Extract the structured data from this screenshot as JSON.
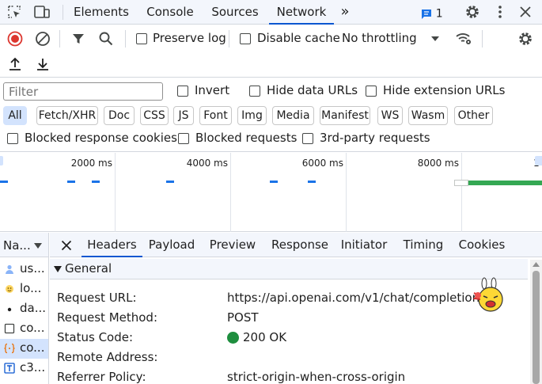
{
  "panel_tabs": [
    {
      "label": "Elements"
    },
    {
      "label": "Console"
    },
    {
      "label": "Sources"
    },
    {
      "label": "Network"
    }
  ],
  "more_tabs_icon": "»",
  "issues": {
    "count": "1"
  },
  "toolbar": {
    "preserve_log_label": "Preserve log",
    "disable_cache_label": "Disable cache",
    "throttling_value": "No throttling"
  },
  "filter": {
    "placeholder": "Filter",
    "invert_label": "Invert",
    "hide_data_urls_label": "Hide data URLs",
    "hide_extension_urls_label": "Hide extension URLs",
    "type_chips": [
      "All",
      "Fetch/XHR",
      "Doc",
      "CSS",
      "JS",
      "Font",
      "Img",
      "Media",
      "Manifest",
      "WS",
      "Wasm",
      "Other"
    ],
    "active_chip": "All",
    "blocked_response_cookies_label": "Blocked response cookies",
    "blocked_requests_label": "Blocked requests",
    "third_party_label": "3rd-party requests"
  },
  "overview": {
    "ticks": [
      "2000 ms",
      "4000 ms",
      "6000 ms",
      "8000 ms",
      "1"
    ]
  },
  "requests_column": {
    "header": "Na...",
    "rows": [
      {
        "name": "us...",
        "icon": "user-icon"
      },
      {
        "name": "lo...",
        "icon": "image-icon"
      },
      {
        "name": "da...",
        "icon": "dot-icon"
      },
      {
        "name": "co...",
        "icon": "blank-doc-icon"
      },
      {
        "name": "co...",
        "icon": "xhr-braces-icon",
        "selected": true
      },
      {
        "name": "c3...",
        "icon": "text-doc-icon"
      }
    ]
  },
  "detail_tabs": [
    {
      "label": "Headers"
    },
    {
      "label": "Payload"
    },
    {
      "label": "Preview"
    },
    {
      "label": "Response"
    },
    {
      "label": "Initiator"
    },
    {
      "label": "Timing"
    },
    {
      "label": "Cookies"
    }
  ],
  "general": {
    "title": "General",
    "rows": [
      {
        "key": "Request URL:",
        "value": "https://api.openai.com/v1/chat/completions"
      },
      {
        "key": "Request Method:",
        "value": "POST"
      },
      {
        "key": "Status Code:",
        "value": "200 OK"
      },
      {
        "key": "Remote Address:",
        "value": ""
      },
      {
        "key": "Referrer Policy:",
        "value": "strict-origin-when-cross-origin"
      }
    ]
  },
  "colors": {
    "accent": "#0b57d0",
    "record_red": "#dc362e",
    "status_green": "#1e8e3e",
    "timeline_green": "#34a853"
  }
}
